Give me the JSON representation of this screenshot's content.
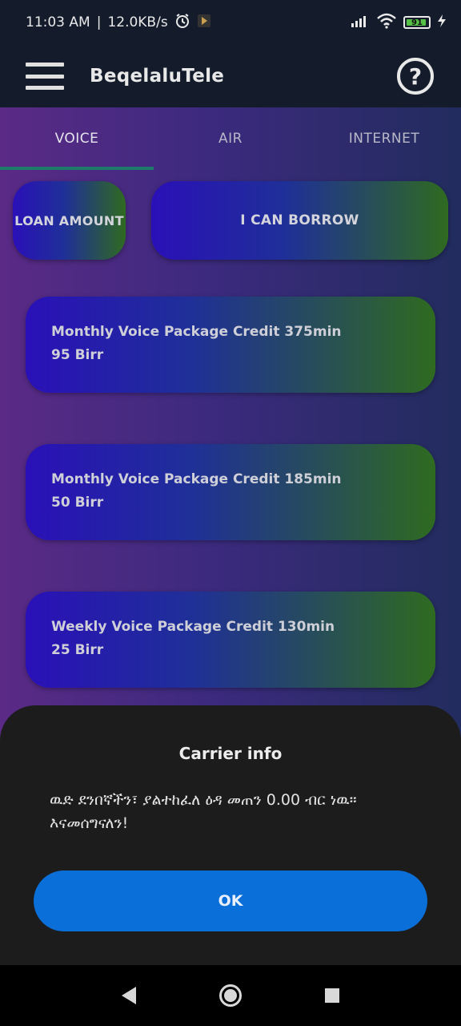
{
  "status_bar": {
    "time": "11:03 AM",
    "separator": "|",
    "speed": "12.0KB/s",
    "alarm_icon": "alarm-clock-icon",
    "app_notification_icon": "app-notification-icon",
    "signal_icon": "cell-signal-icon",
    "wifi_icon": "wifi-icon",
    "battery_level": "91",
    "charging_icon": "charging-bolt-icon"
  },
  "app_bar": {
    "menu_icon": "hamburger-menu-icon",
    "title": "BeqelaluTele",
    "help_icon": "help-question-icon"
  },
  "tabs": [
    {
      "label": "VOICE",
      "active": true
    },
    {
      "label": "AIR",
      "active": false
    },
    {
      "label": "INTERNET",
      "active": false
    }
  ],
  "actions": {
    "loan_amount": "LOAN AMOUNT",
    "i_can_borrow": "I CAN BORROW"
  },
  "packages": [
    {
      "name": "Monthly Voice Package Credit 375min",
      "price": "95 Birr"
    },
    {
      "name": "Monthly Voice Package Credit 185min",
      "price": "50 Birr"
    },
    {
      "name": "Weekly Voice Package Credit 130min",
      "price": "25 Birr"
    }
  ],
  "dialog": {
    "title": "Carrier info",
    "message": "ዉድ ደንበኛችን፣ ያልተከፈለ ዕዳ መጠን 0.00 ብር ነዉ። እናመሰግናለን!",
    "ok_label": "OK"
  },
  "colors": {
    "accent_blue": "#0a6fd8",
    "tab_indicator": "#1e7a6a",
    "gradient_start": "#2a10b8",
    "gradient_end": "#2f6a20"
  }
}
